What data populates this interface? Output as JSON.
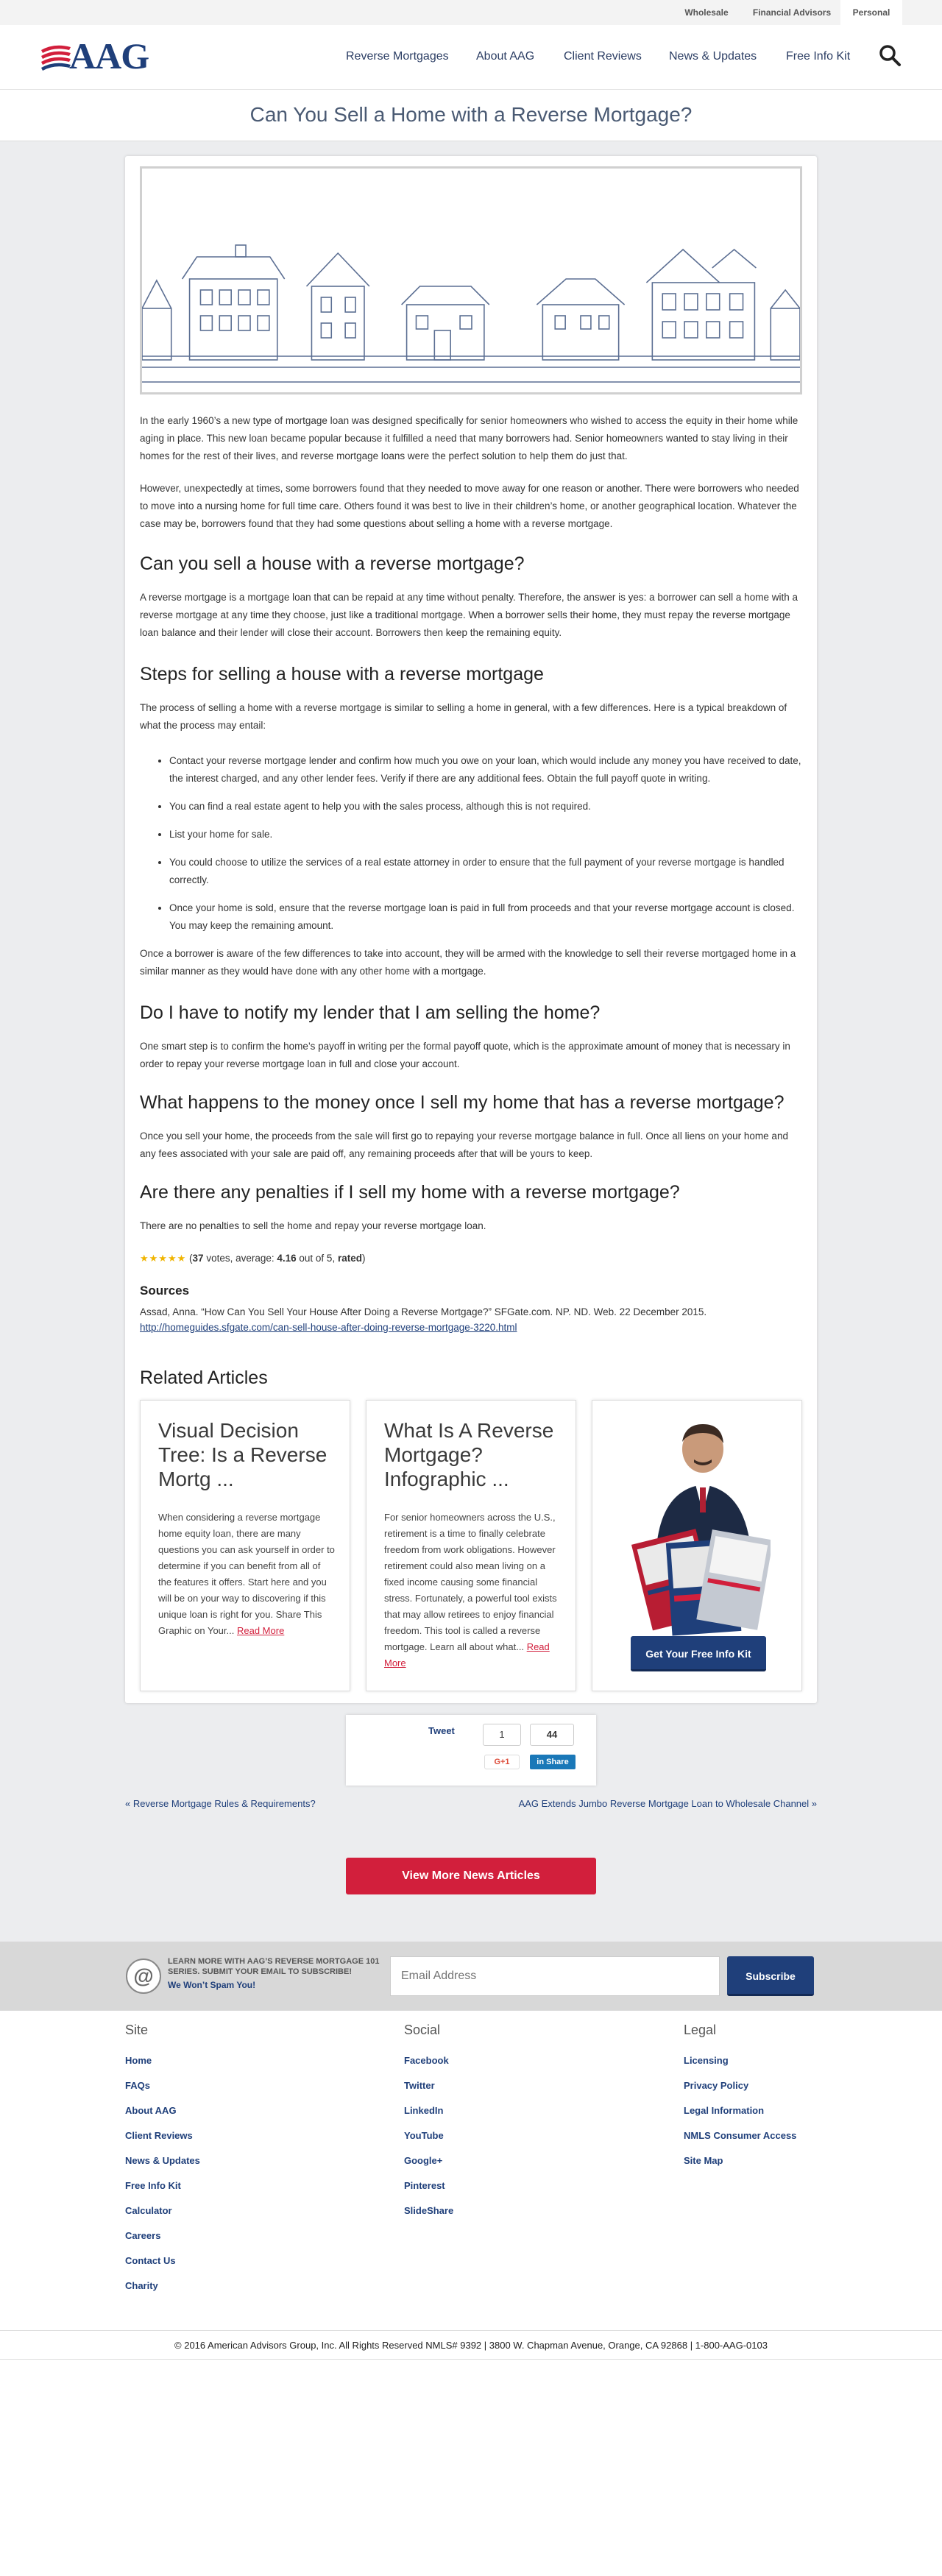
{
  "utility_nav": [
    {
      "label": "Wholesale"
    },
    {
      "label": "Financial Advisors"
    },
    {
      "label": "Personal",
      "active": true
    }
  ],
  "logo": {
    "text": "AAG",
    "colors": {
      "primary": "#1f3f7a",
      "accent": "#d21f3c"
    }
  },
  "main_nav": [
    {
      "label": "Reverse Mortgages"
    },
    {
      "label": "About AAG"
    },
    {
      "label": "Client Reviews"
    },
    {
      "label": "News & Updates"
    },
    {
      "label": "Free Info Kit"
    }
  ],
  "search": {
    "icon": "search-icon"
  },
  "page_title": "Can You Sell a Home with a Reverse Mortgage?",
  "article": {
    "paragraphs": [
      "In the early 1960’s a new type of mortgage loan was designed specifically for senior homeowners who wished to access the equity in their home while aging in place.  This new loan became popular because it fulfilled a need that many borrowers had.  Senior homeowners wanted to stay living in their homes for the rest of their lives, and reverse mortgage loans were the perfect solution to help them do just that.",
      "However, unexpectedly at times, some borrowers found that they needed to move away for one reason or another.  There were borrowers who needed to move into a nursing home for full time care.  Others found it was best to live in their children’s home, or another geographical location.  Whatever the case may be, borrowers found that they had some questions about selling a home with a reverse mortgage."
    ],
    "section1": {
      "heading": "Can you sell a house with a reverse mortgage?",
      "body": "A reverse mortgage is a mortgage loan that can be repaid at any time without penalty.  Therefore, the answer is yes: a borrower can sell a home with a reverse mortgage at any time they choose, just like a traditional mortgage.  When a borrower sells their home, they must repay the reverse mortgage loan balance and their lender will close their account.  Borrowers then keep the remaining equity."
    },
    "section2": {
      "heading": "Steps for selling a house with a reverse mortgage",
      "intro": "The process of selling a home with a reverse mortgage is similar to selling a home in general, with a few differences.  Here is a typical breakdown of what the process may entail:",
      "steps": [
        "Contact your reverse mortgage lender and confirm how much you owe on your loan, which would include any money you have received to date, the interest charged, and any other lender fees. Verify if there are any additional fees.  Obtain the full payoff quote in writing.",
        "You can find a real estate agent to help you with the sales process, although this is not required.",
        "List your home for sale.",
        "You could choose to utilize the services of a real estate attorney in order to ensure that the full payment of your reverse mortgage is handled correctly.",
        "Once your home is sold, ensure that the reverse mortgage loan is paid in full from proceeds and that your reverse mortgage account is closed. You may keep the remaining amount."
      ],
      "outro": "Once a borrower is aware of the few differences to take into account, they will be armed with the knowledge to sell their reverse mortgaged home in a similar manner as they would have done with any other home with a mortgage."
    },
    "section3": {
      "heading": "Do I have to notify my lender that I am selling the home?",
      "body": "One smart step is to confirm the home’s payoff in writing per the formal payoff quote, which is the approximate amount of money that is necessary in order to repay your reverse mortgage loan in full and close your account."
    },
    "section4": {
      "heading": "What happens to the money once I sell my home that has a reverse mortgage?",
      "body": "Once you sell your home, the proceeds from the sale will first go to repaying your reverse mortgage balance in full. Once all liens on your home and any fees associated with your sale are paid off, any remaining proceeds after that will be yours to keep."
    },
    "section5": {
      "heading": "Are there any penalties if I sell my home with a reverse mortgage?",
      "body": "There are no penalties to sell the home and repay your reverse mortgage loan."
    },
    "rating": {
      "stars": "★★★★★",
      "votes": "37",
      "votes_text": " votes, average: ",
      "average": "4.16",
      "out_of": " out of 5, ",
      "rated": "rated"
    },
    "sources": {
      "heading": "Sources",
      "citation": "Assad, Anna.  “How Can You Sell Your House After Doing a Reverse Mortgage?”  SFGate.com.  NP.  ND.  Web.  22 December 2015.",
      "link": "http://homeguides.sfgate.com/can-sell-house-after-doing-reverse-mortgage-3220.html"
    }
  },
  "related": {
    "heading": "Related Articles",
    "cards": [
      {
        "title": "Visual Decision Tree: Is a Reverse Mortg ...",
        "excerpt": "When considering a reverse mortgage home equity loan, there are many questions you can ask yourself in order to determine if you can benefit from all of the features it offers. Start here and you will be on your way to discovering if this unique loan is right for you. Share This Graphic on Your...",
        "read_more": "Read More"
      },
      {
        "title": "What Is A Reverse Mortgage? Infographic ...",
        "excerpt": "For senior homeowners across the U.S., retirement is a time to finally celebrate freedom from work obligations. However retirement could also mean living on a fixed income causing some financial stress. Fortunately, a powerful tool exists that may allow retirees to enjoy financial freedom. This tool is called a reverse mortgage. Learn all about what...",
        "read_more": "Read More"
      }
    ],
    "kit": {
      "button": "Get Your Free Info Kit"
    }
  },
  "share": {
    "tweet": "Tweet",
    "tweet_count": "1",
    "fb_count": "44",
    "gplus": "G+1",
    "linkedin": "Share"
  },
  "post_nav": {
    "prev": "« Reverse Mortgage Rules & Requirements?",
    "next": "AAG Extends Jumbo Reverse Mortgage Loan to Wholesale Channel »"
  },
  "more_news_button": "View More News Articles",
  "newsletter": {
    "text": "LEARN MORE WITH AAG’S REVERSE MORTGAGE 101 SERIES. SUBMIT YOUR EMAIL TO SUBSCRIBE!",
    "no_spam": "We Won’t Spam You!",
    "placeholder": "Email Address",
    "button": "Subscribe"
  },
  "footer": {
    "site": {
      "heading": "Site",
      "links": [
        "Home",
        "FAQs",
        "About AAG",
        "Client Reviews",
        "News & Updates",
        "Free Info Kit",
        "Calculator",
        "Careers",
        "Contact Us",
        "Charity"
      ]
    },
    "social": {
      "heading": "Social",
      "links": [
        "Facebook",
        "Twitter",
        "LinkedIn",
        "YouTube",
        "Google+",
        "Pinterest",
        "SlideShare"
      ]
    },
    "legal": {
      "heading": "Legal",
      "links": [
        "Licensing",
        "Privacy Policy",
        "Legal Information",
        "NMLS Consumer Access",
        "Site Map"
      ]
    },
    "copyright": "© 2016 American Advisors Group, Inc. All Rights Reserved NMLS# 9392 | 3800 W. Chapman Avenue, Orange, CA 92868 | 1-800-AAG-0103"
  }
}
